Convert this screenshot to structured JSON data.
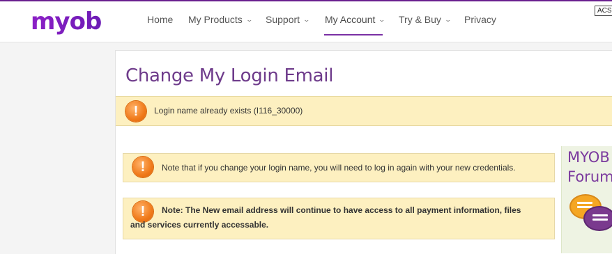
{
  "header": {
    "logo": "myob",
    "nav": [
      {
        "label": "Home",
        "has_dropdown": false
      },
      {
        "label": "My Products",
        "has_dropdown": true
      },
      {
        "label": "Support",
        "has_dropdown": true
      },
      {
        "label": "My Account",
        "has_dropdown": true,
        "active": true
      },
      {
        "label": "Try & Buy",
        "has_dropdown": true
      },
      {
        "label": "Privacy",
        "has_dropdown": false
      }
    ],
    "acs_badge": "ACS"
  },
  "page": {
    "title": "Change My Login Email",
    "error_alert": "Login name already exists (I116_30000)",
    "note1": "Note that if you change your login name, you will need to log in again with your new credentials.",
    "note2": "Note: The New email address will continue to have access to all payment information, files and services currently accessable."
  },
  "sidebar": {
    "forum_title_line1": "MYOB",
    "forum_title_line2": "Forum"
  },
  "colors": {
    "brand": "#8c20c6",
    "title": "#6e3b8b",
    "alert_bg": "#fdf0c0",
    "warning_icon": "#f07a1a"
  },
  "icons": [
    "warning-icon",
    "chevron-down-icon",
    "forum-chat-icon"
  ]
}
